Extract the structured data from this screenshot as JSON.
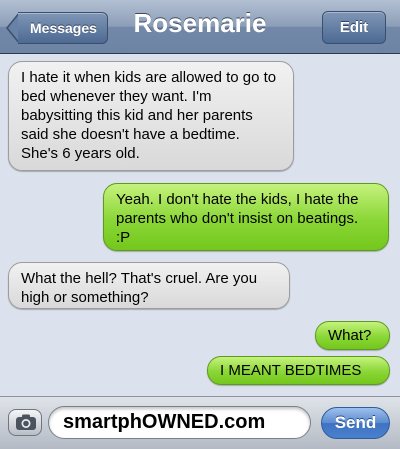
{
  "header": {
    "title": "Rosemarie",
    "back_label": "Messages",
    "edit_label": "Edit"
  },
  "messages": [
    {
      "direction": "received",
      "text": "I hate it when kids are allowed to go to bed whenever they want. I'm babysitting this kid and her parents said she doesn't have a bedtime. She's 6 years old."
    },
    {
      "direction": "sent",
      "text": "Yeah. I don't hate the kids, I hate the parents who don't insist on beatings. :P"
    },
    {
      "direction": "received",
      "text": "What the hell? That's cruel. Are you high or something?"
    },
    {
      "direction": "sent",
      "text": "What?"
    },
    {
      "direction": "sent",
      "text": "I MEANT BEDTIMES"
    }
  ],
  "composer": {
    "field_text": "smartphOWNED.com",
    "send_label": "Send",
    "camera_icon": "camera-icon"
  },
  "colors": {
    "sent_bubble": "#8ad636",
    "received_bubble": "#e4e4e4",
    "background": "#dbe2ed",
    "nav_bar": "#7388a8"
  }
}
